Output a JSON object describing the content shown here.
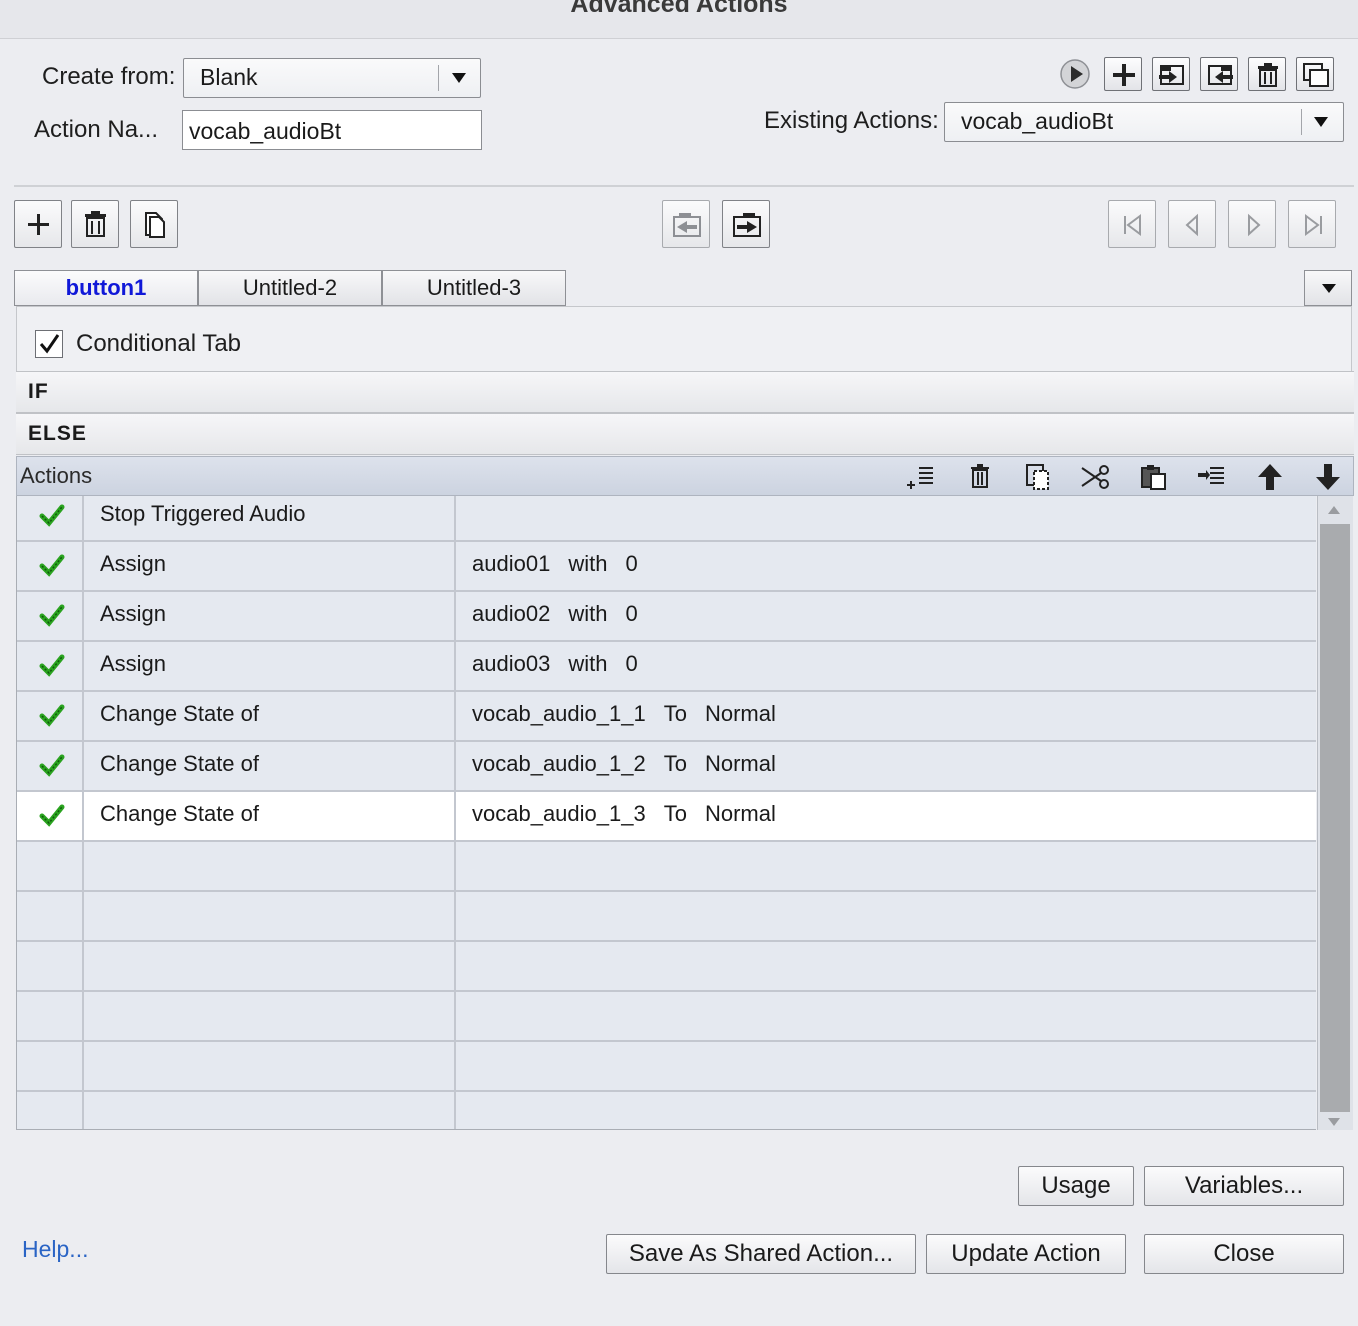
{
  "window": {
    "title": "Advanced Actions"
  },
  "form": {
    "create_from_label": "Create from:",
    "create_from_value": "Blank",
    "action_name_label": "Action Na...",
    "action_name_value": "vocab_audioBt",
    "existing_actions_label": "Existing Actions:",
    "existing_actions_value": "vocab_audioBt"
  },
  "tabs": [
    {
      "label": "button1",
      "active": true
    },
    {
      "label": "Untitled-2",
      "active": false
    },
    {
      "label": "Untitled-3",
      "active": false
    }
  ],
  "conditional": {
    "label": "Conditional Tab",
    "checked": true
  },
  "sections": {
    "if_label": "IF",
    "else_label": "ELSE",
    "actions_label": "Actions"
  },
  "actions": [
    {
      "action": "Stop Triggered Audio",
      "params": []
    },
    {
      "action": "Assign",
      "params": [
        "audio01",
        "with",
        "0"
      ]
    },
    {
      "action": "Assign",
      "params": [
        "audio02",
        "with",
        "0"
      ]
    },
    {
      "action": "Assign",
      "params": [
        "audio03",
        "with",
        "0"
      ]
    },
    {
      "action": "Change State of",
      "params": [
        "vocab_audio_1_1",
        "To",
        "Normal"
      ]
    },
    {
      "action": "Change State of",
      "params": [
        "vocab_audio_1_2",
        "To",
        "Normal"
      ]
    },
    {
      "action": "Change State of",
      "params": [
        "vocab_audio_1_3",
        "To",
        "Normal"
      ],
      "selected": true
    }
  ],
  "footer": {
    "usage": "Usage",
    "variables": "Variables...",
    "help": "Help...",
    "save_shared": "Save As Shared Action...",
    "update": "Update Action",
    "close": "Close"
  },
  "colors": {
    "active_tab": "#1018d8",
    "help_link": "#2a64c5",
    "check": "#2aa31f"
  }
}
